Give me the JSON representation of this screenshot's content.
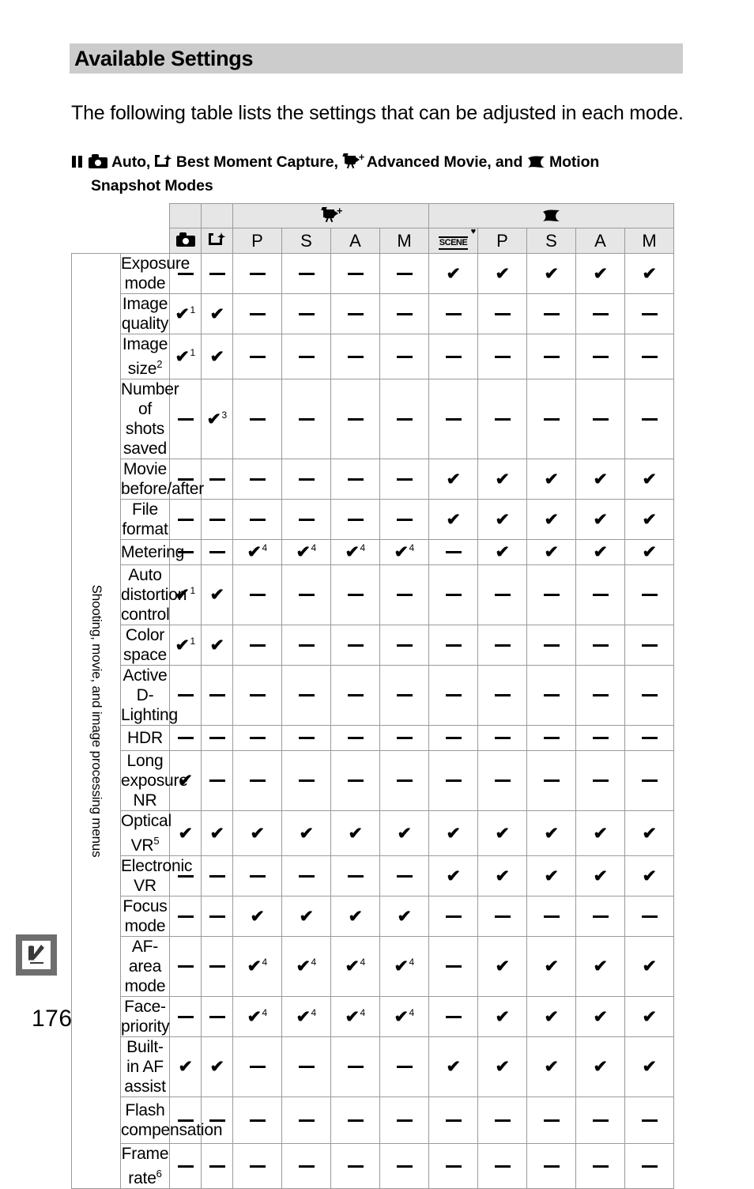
{
  "page": {
    "title": "Available Settings",
    "intro": "The following table lists the settings that can be adjusted in each mode.",
    "subheading": {
      "part1": "Auto,",
      "part2": "Best Moment Capture,",
      "part3": "Advanced Movie, and",
      "part4": "Motion",
      "part5": "Snapshot Modes",
      "icons": [
        "pause-icon",
        "camera-icon",
        "best-moment-capture-icon",
        "advanced-movie-icon",
        "motion-snapshot-icon"
      ]
    },
    "page_number": "176",
    "footer_tab_icon": "pencil-menu-tab-icon"
  },
  "table": {
    "side_label": "Shooting, movie, and image processing menus",
    "group_headers": [
      {
        "label": "",
        "icon": "",
        "span": 1
      },
      {
        "label": "",
        "icon": "",
        "span": 1
      },
      {
        "label": "",
        "icon": "advanced-movie-icon",
        "span": 4
      },
      {
        "label": "",
        "icon": "motion-snapshot-icon",
        "span": 5
      }
    ],
    "columns": [
      {
        "key": "auto",
        "label": "",
        "icon": "camera-icon"
      },
      {
        "key": "bmc",
        "label": "",
        "icon": "best-moment-capture-icon"
      },
      {
        "key": "mv_P",
        "label": "P",
        "icon": ""
      },
      {
        "key": "mv_S",
        "label": "S",
        "icon": ""
      },
      {
        "key": "mv_A",
        "label": "A",
        "icon": ""
      },
      {
        "key": "mv_M",
        "label": "M",
        "icon": ""
      },
      {
        "key": "ms_SCENE",
        "label": "SCENE",
        "icon": "scene-heart-icon"
      },
      {
        "key": "ms_P",
        "label": "P",
        "icon": ""
      },
      {
        "key": "ms_S",
        "label": "S",
        "icon": ""
      },
      {
        "key": "ms_A",
        "label": "A",
        "icon": ""
      },
      {
        "key": "ms_M",
        "label": "M",
        "icon": ""
      }
    ],
    "rows": [
      {
        "label": "Exposure mode",
        "note": "",
        "tall": false,
        "cells": [
          "-",
          "-",
          "-",
          "-",
          "-",
          "-",
          "v",
          "v",
          "v",
          "v",
          "v"
        ],
        "notes": [
          "",
          "",
          "",
          "",
          "",
          "",
          "",
          "",
          "",
          "",
          ""
        ]
      },
      {
        "label": "Image quality",
        "note": "",
        "tall": false,
        "cells": [
          "v",
          "v",
          "-",
          "-",
          "-",
          "-",
          "-",
          "-",
          "-",
          "-",
          "-"
        ],
        "notes": [
          "1",
          "",
          "",
          "",
          "",
          "",
          "",
          "",
          "",
          "",
          ""
        ]
      },
      {
        "label": "Image size",
        "note": "2",
        "tall": false,
        "cells": [
          "v",
          "v",
          "-",
          "-",
          "-",
          "-",
          "-",
          "-",
          "-",
          "-",
          "-"
        ],
        "notes": [
          "1",
          "",
          "",
          "",
          "",
          "",
          "",
          "",
          "",
          "",
          ""
        ]
      },
      {
        "label": "Number of shots saved",
        "note": "",
        "tall": true,
        "cells": [
          "-",
          "v",
          "-",
          "-",
          "-",
          "-",
          "-",
          "-",
          "-",
          "-",
          "-"
        ],
        "notes": [
          "",
          "3",
          "",
          "",
          "",
          "",
          "",
          "",
          "",
          "",
          ""
        ]
      },
      {
        "label": "Movie before/after",
        "note": "",
        "tall": false,
        "cells": [
          "-",
          "-",
          "-",
          "-",
          "-",
          "-",
          "v",
          "v",
          "v",
          "v",
          "v"
        ],
        "notes": [
          "",
          "",
          "",
          "",
          "",
          "",
          "",
          "",
          "",
          "",
          ""
        ]
      },
      {
        "label": "File format",
        "note": "",
        "tall": false,
        "cells": [
          "-",
          "-",
          "-",
          "-",
          "-",
          "-",
          "v",
          "v",
          "v",
          "v",
          "v"
        ],
        "notes": [
          "",
          "",
          "",
          "",
          "",
          "",
          "",
          "",
          "",
          "",
          ""
        ]
      },
      {
        "label": "Metering",
        "note": "",
        "tall": false,
        "cells": [
          "-",
          "-",
          "v",
          "v",
          "v",
          "v",
          "-",
          "v",
          "v",
          "v",
          "v"
        ],
        "notes": [
          "",
          "",
          "4",
          "4",
          "4",
          "4",
          "",
          "",
          "",
          "",
          ""
        ]
      },
      {
        "label": "Auto distortion control",
        "note": "",
        "tall": true,
        "cells": [
          "v",
          "v",
          "-",
          "-",
          "-",
          "-",
          "-",
          "-",
          "-",
          "-",
          "-"
        ],
        "notes": [
          "1",
          "",
          "",
          "",
          "",
          "",
          "",
          "",
          "",
          "",
          ""
        ]
      },
      {
        "label": "Color space",
        "note": "",
        "tall": false,
        "cells": [
          "v",
          "v",
          "-",
          "-",
          "-",
          "-",
          "-",
          "-",
          "-",
          "-",
          "-"
        ],
        "notes": [
          "1",
          "",
          "",
          "",
          "",
          "",
          "",
          "",
          "",
          "",
          ""
        ]
      },
      {
        "label": "Active D-Lighting",
        "note": "",
        "tall": false,
        "cells": [
          "-",
          "-",
          "-",
          "-",
          "-",
          "-",
          "-",
          "-",
          "-",
          "-",
          "-"
        ],
        "notes": [
          "",
          "",
          "",
          "",
          "",
          "",
          "",
          "",
          "",
          "",
          ""
        ]
      },
      {
        "label": "HDR",
        "note": "",
        "tall": false,
        "cells": [
          "-",
          "-",
          "-",
          "-",
          "-",
          "-",
          "-",
          "-",
          "-",
          "-",
          "-"
        ],
        "notes": [
          "",
          "",
          "",
          "",
          "",
          "",
          "",
          "",
          "",
          "",
          ""
        ]
      },
      {
        "label": "Long exposure NR",
        "note": "",
        "tall": false,
        "cells": [
          "v",
          "-",
          "-",
          "-",
          "-",
          "-",
          "-",
          "-",
          "-",
          "-",
          "-"
        ],
        "notes": [
          "",
          "",
          "",
          "",
          "",
          "",
          "",
          "",
          "",
          "",
          ""
        ]
      },
      {
        "label": "Optical VR",
        "note": "5",
        "tall": false,
        "cells": [
          "v",
          "v",
          "v",
          "v",
          "v",
          "v",
          "v",
          "v",
          "v",
          "v",
          "v"
        ],
        "notes": [
          "",
          "",
          "",
          "",
          "",
          "",
          "",
          "",
          "",
          "",
          ""
        ]
      },
      {
        "label": "Electronic VR",
        "note": "",
        "tall": false,
        "cells": [
          "-",
          "-",
          "-",
          "-",
          "-",
          "-",
          "v",
          "v",
          "v",
          "v",
          "v"
        ],
        "notes": [
          "",
          "",
          "",
          "",
          "",
          "",
          "",
          "",
          "",
          "",
          ""
        ]
      },
      {
        "label": "Focus mode",
        "note": "",
        "tall": false,
        "cells": [
          "-",
          "-",
          "v",
          "v",
          "v",
          "v",
          "-",
          "-",
          "-",
          "-",
          "-"
        ],
        "notes": [
          "",
          "",
          "",
          "",
          "",
          "",
          "",
          "",
          "",
          "",
          ""
        ]
      },
      {
        "label": "AF-area mode",
        "note": "",
        "tall": false,
        "cells": [
          "-",
          "-",
          "v",
          "v",
          "v",
          "v",
          "-",
          "v",
          "v",
          "v",
          "v"
        ],
        "notes": [
          "",
          "",
          "4",
          "4",
          "4",
          "4",
          "",
          "",
          "",
          "",
          ""
        ]
      },
      {
        "label": "Face-priority",
        "note": "",
        "tall": false,
        "cells": [
          "-",
          "-",
          "v",
          "v",
          "v",
          "v",
          "-",
          "v",
          "v",
          "v",
          "v"
        ],
        "notes": [
          "",
          "",
          "4",
          "4",
          "4",
          "4",
          "",
          "",
          "",
          "",
          ""
        ]
      },
      {
        "label": "Built-in AF assist",
        "note": "",
        "tall": false,
        "cells": [
          "v",
          "v",
          "-",
          "-",
          "-",
          "-",
          "v",
          "v",
          "v",
          "v",
          "v"
        ],
        "notes": [
          "",
          "",
          "",
          "",
          "",
          "",
          "",
          "",
          "",
          "",
          ""
        ]
      },
      {
        "label": "Flash compensation",
        "note": "",
        "tall": true,
        "cells": [
          "-",
          "-",
          "-",
          "-",
          "-",
          "-",
          "-",
          "-",
          "-",
          "-",
          "-"
        ],
        "notes": [
          "",
          "",
          "",
          "",
          "",
          "",
          "",
          "",
          "",
          "",
          ""
        ]
      },
      {
        "label": "Frame rate",
        "note": "6",
        "tall": false,
        "cells": [
          "-",
          "-",
          "-",
          "-",
          "-",
          "-",
          "-",
          "-",
          "-",
          "-",
          "-"
        ],
        "notes": [
          "",
          "",
          "",
          "",
          "",
          "",
          "",
          "",
          "",
          "",
          ""
        ]
      }
    ]
  },
  "colors": {
    "heading_band": "#cccccc",
    "header_cell": "#e6e6e6",
    "grid_line": "#9a9a9a",
    "tab_icon_bg": "#6e6e6e",
    "text": "#000000"
  }
}
